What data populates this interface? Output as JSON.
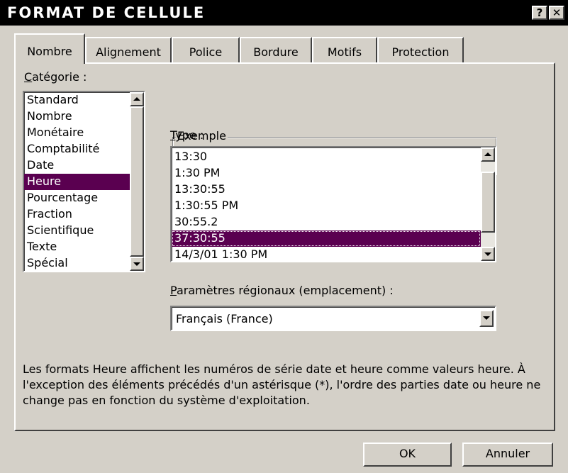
{
  "window": {
    "title": "Format de cellule",
    "help_label": "?",
    "close_label": "✕"
  },
  "tabs": [
    {
      "label": "Nombre",
      "active": true
    },
    {
      "label": "Alignement"
    },
    {
      "label": "Police"
    },
    {
      "label": "Bordure"
    },
    {
      "label": "Motifs"
    },
    {
      "label": "Protection"
    }
  ],
  "category": {
    "label_first": "C",
    "label_rest": "atégorie :",
    "items": [
      "Standard",
      "Nombre",
      "Monétaire",
      "Comptabilité",
      "Date",
      "Heure",
      "Pourcentage",
      "Fraction",
      "Scientifique",
      "Texte",
      "Spécial"
    ],
    "selected": "Heure"
  },
  "exemple": {
    "label": "Exemple",
    "value": ""
  },
  "type": {
    "label_first": "T",
    "label_rest": "ype :",
    "items": [
      "13:30",
      "1:30 PM",
      "13:30:55",
      "1:30:55 PM",
      "30:55.2",
      "37:30:55",
      "14/3/01 1:30 PM"
    ],
    "selected": "37:30:55"
  },
  "locale": {
    "label_first": "P",
    "label_rest": "aramètres régionaux (emplacement) :",
    "value": "Français (France)"
  },
  "description": "Les formats Heure affichent les numéros de série date et heure comme valeurs heure. À l'exception des éléments précédés d'un astérisque (*), l'ordre des parties date ou heure ne change pas en fonction du système d'exploitation.",
  "buttons": {
    "ok": "OK",
    "cancel": "Annuler"
  },
  "colors": {
    "selection": "#5a0050",
    "face": "#d4d0c8",
    "titlebar": "#000000"
  },
  "icons": {
    "scroll_up": "arrow-up-icon",
    "scroll_down": "arrow-down-icon",
    "dropdown": "chevron-down-icon"
  }
}
